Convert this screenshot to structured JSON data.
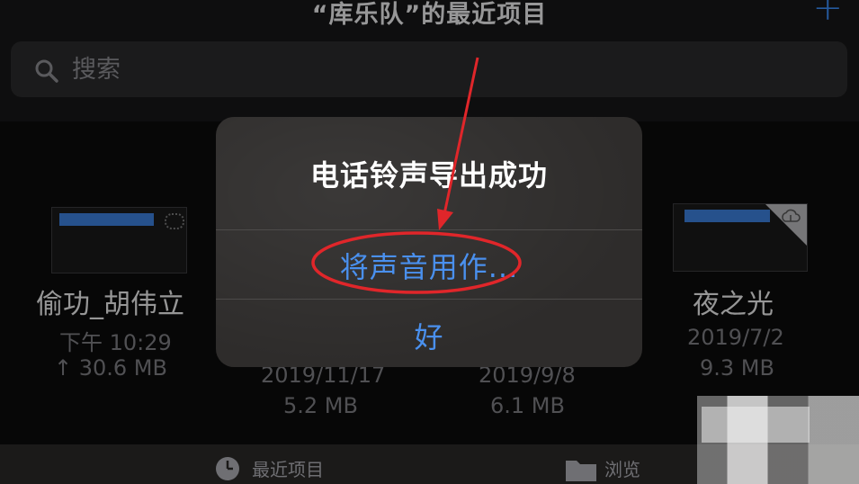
{
  "header": {
    "title": "“库乐队”的最近项目",
    "add_icon": "plus-icon"
  },
  "search": {
    "placeholder": "搜索",
    "icon": "search-icon"
  },
  "files": [
    {
      "name": "偷功_胡伟立",
      "date": "下午 10:29",
      "size": "↑ 30.6 MB"
    },
    {
      "name": "",
      "date": "2019/11/17",
      "size": "5.2 MB"
    },
    {
      "name": "",
      "date": "2019/9/8",
      "size": "6.1 MB"
    },
    {
      "name": "夜之光",
      "date": "2019/7/2",
      "size": "9.3 MB"
    }
  ],
  "dialog": {
    "title": "电话铃声导出成功",
    "use_sound_as": "将声音用作...",
    "ok": "好"
  },
  "tabbar": {
    "recent": "最近项目",
    "browse": "浏览"
  },
  "colors": {
    "accent": "#4a90ee",
    "annotation": "#e0262a"
  }
}
